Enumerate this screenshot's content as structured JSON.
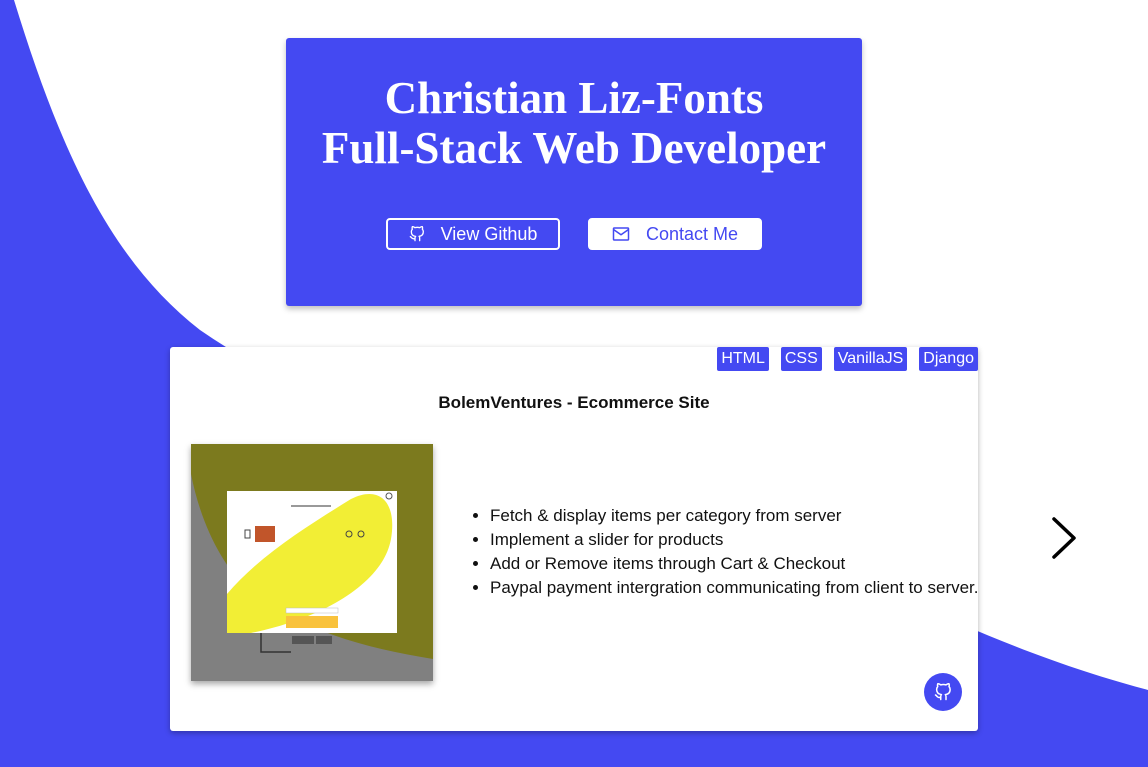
{
  "hero": {
    "name": "Christian Liz-Fonts",
    "role": "Full-Stack Web Developer",
    "github_button": "View Github",
    "contact_button": "Contact Me"
  },
  "project": {
    "tags": [
      "HTML",
      "CSS",
      "VanillaJS",
      "Django"
    ],
    "title": "BolemVentures - Ecommerce Site",
    "features": [
      "Fetch & display items per category from server",
      "Implement a slider for products",
      "Add or Remove items through Cart & Checkout",
      "Paypal payment intergration communicating from client to server."
    ]
  },
  "colors": {
    "accent": "#4449f2",
    "background": "#ffffff"
  },
  "icons": {
    "github": "github-icon",
    "mail": "mail-icon",
    "next": "chevron-right-icon"
  }
}
